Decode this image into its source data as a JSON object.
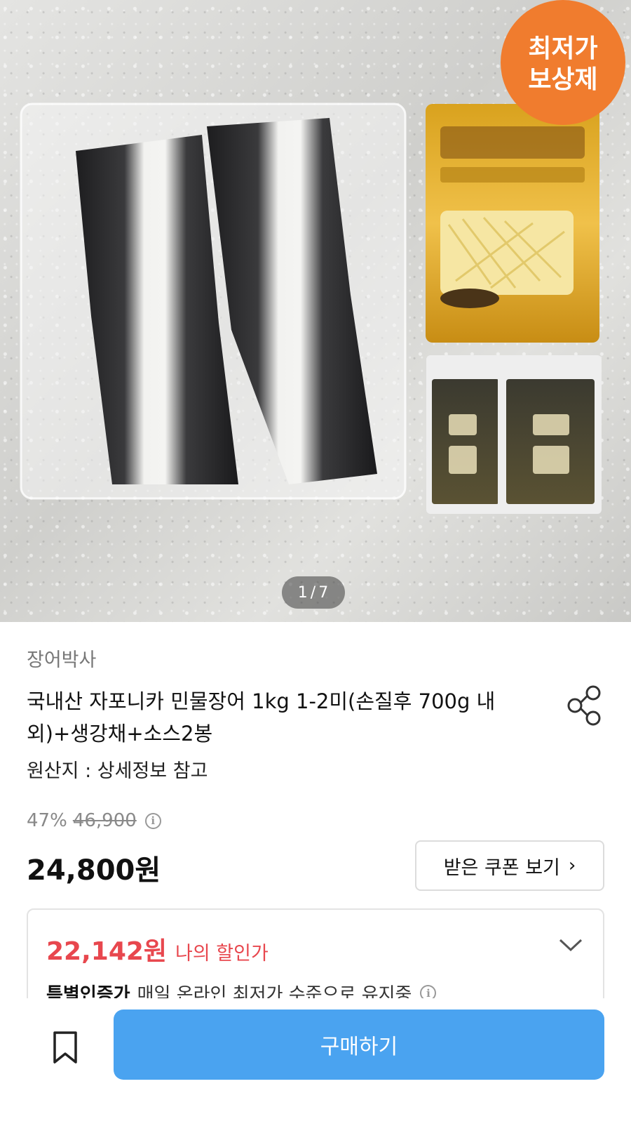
{
  "hero": {
    "badge_line1": "최저가",
    "badge_line2": "보상제",
    "counter_current": "1",
    "counter_total": "7"
  },
  "product": {
    "seller": "장어박사",
    "title": "국내산 자포니카 민물장어 1kg 1-2미(손질후 700g 내외)+생강채+소스2봉",
    "origin": "원산지 : 상세정보 참고"
  },
  "pricing": {
    "discount_rate": "47%",
    "original_price": "46,900",
    "price": "24,800원",
    "coupon_button": "받은 쿠폰 보기",
    "my_price": "22,142원",
    "my_price_label": "나의 할인가",
    "special_label": "특별인증가",
    "special_desc": "매일 온라인 최저가 수준으로 유지중"
  },
  "actions": {
    "buy_label": "구매하기"
  },
  "colors": {
    "accent_blue": "#4aa3f0",
    "discount_red": "#e8474e",
    "badge_orange": "#f07c2e"
  },
  "icons": [
    "share-icon",
    "info-icon",
    "chevron-right-icon",
    "chevron-down-icon",
    "bookmark-icon"
  ]
}
